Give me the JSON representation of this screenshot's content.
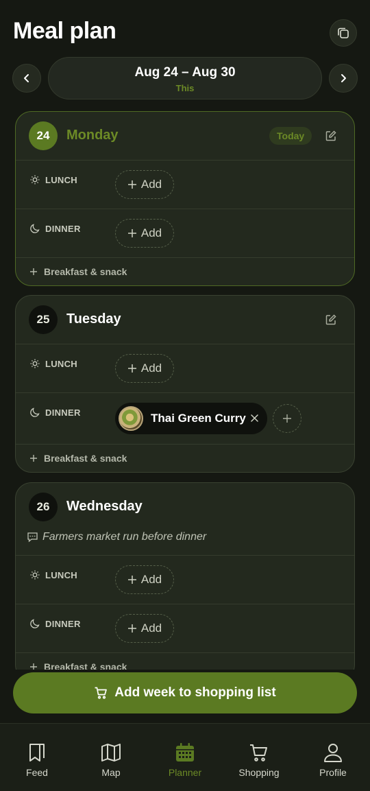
{
  "header": {
    "title": "Meal plan"
  },
  "week": {
    "range": "Aug 24 – Aug 30",
    "sublabel": "This"
  },
  "days": [
    {
      "number": "24",
      "name": "Monday",
      "badge": "Today",
      "lunch_label": "LUNCH",
      "lunch_add": "Add",
      "dinner_label": "DINNER",
      "dinner_add": "Add",
      "extra": "Breakfast & snack"
    },
    {
      "number": "25",
      "name": "Tuesday",
      "lunch_label": "LUNCH",
      "lunch_add": "Add",
      "dinner_label": "DINNER",
      "dinner_recipe": "Thai Green Curry",
      "extra": "Breakfast & snack"
    },
    {
      "number": "26",
      "name": "Wednesday",
      "note": "Farmers market run before dinner",
      "lunch_label": "LUNCH",
      "lunch_add": "Add",
      "dinner_label": "DINNER",
      "dinner_add": "Add",
      "extra": "Breakfast & snack"
    }
  ],
  "cta": {
    "label": "Add week to shopping list"
  },
  "nav": [
    {
      "label": "Feed",
      "icon": "bookmark-icon"
    },
    {
      "label": "Map",
      "icon": "map-icon"
    },
    {
      "label": "Planner",
      "icon": "calendar-icon",
      "active": true
    },
    {
      "label": "Shopping",
      "icon": "cart-icon"
    },
    {
      "label": "Profile",
      "icon": "user-icon"
    }
  ],
  "colors": {
    "accent": "#5b7a22",
    "accent_text": "#6c8a26",
    "background": "#151812",
    "card": "#23291e"
  }
}
